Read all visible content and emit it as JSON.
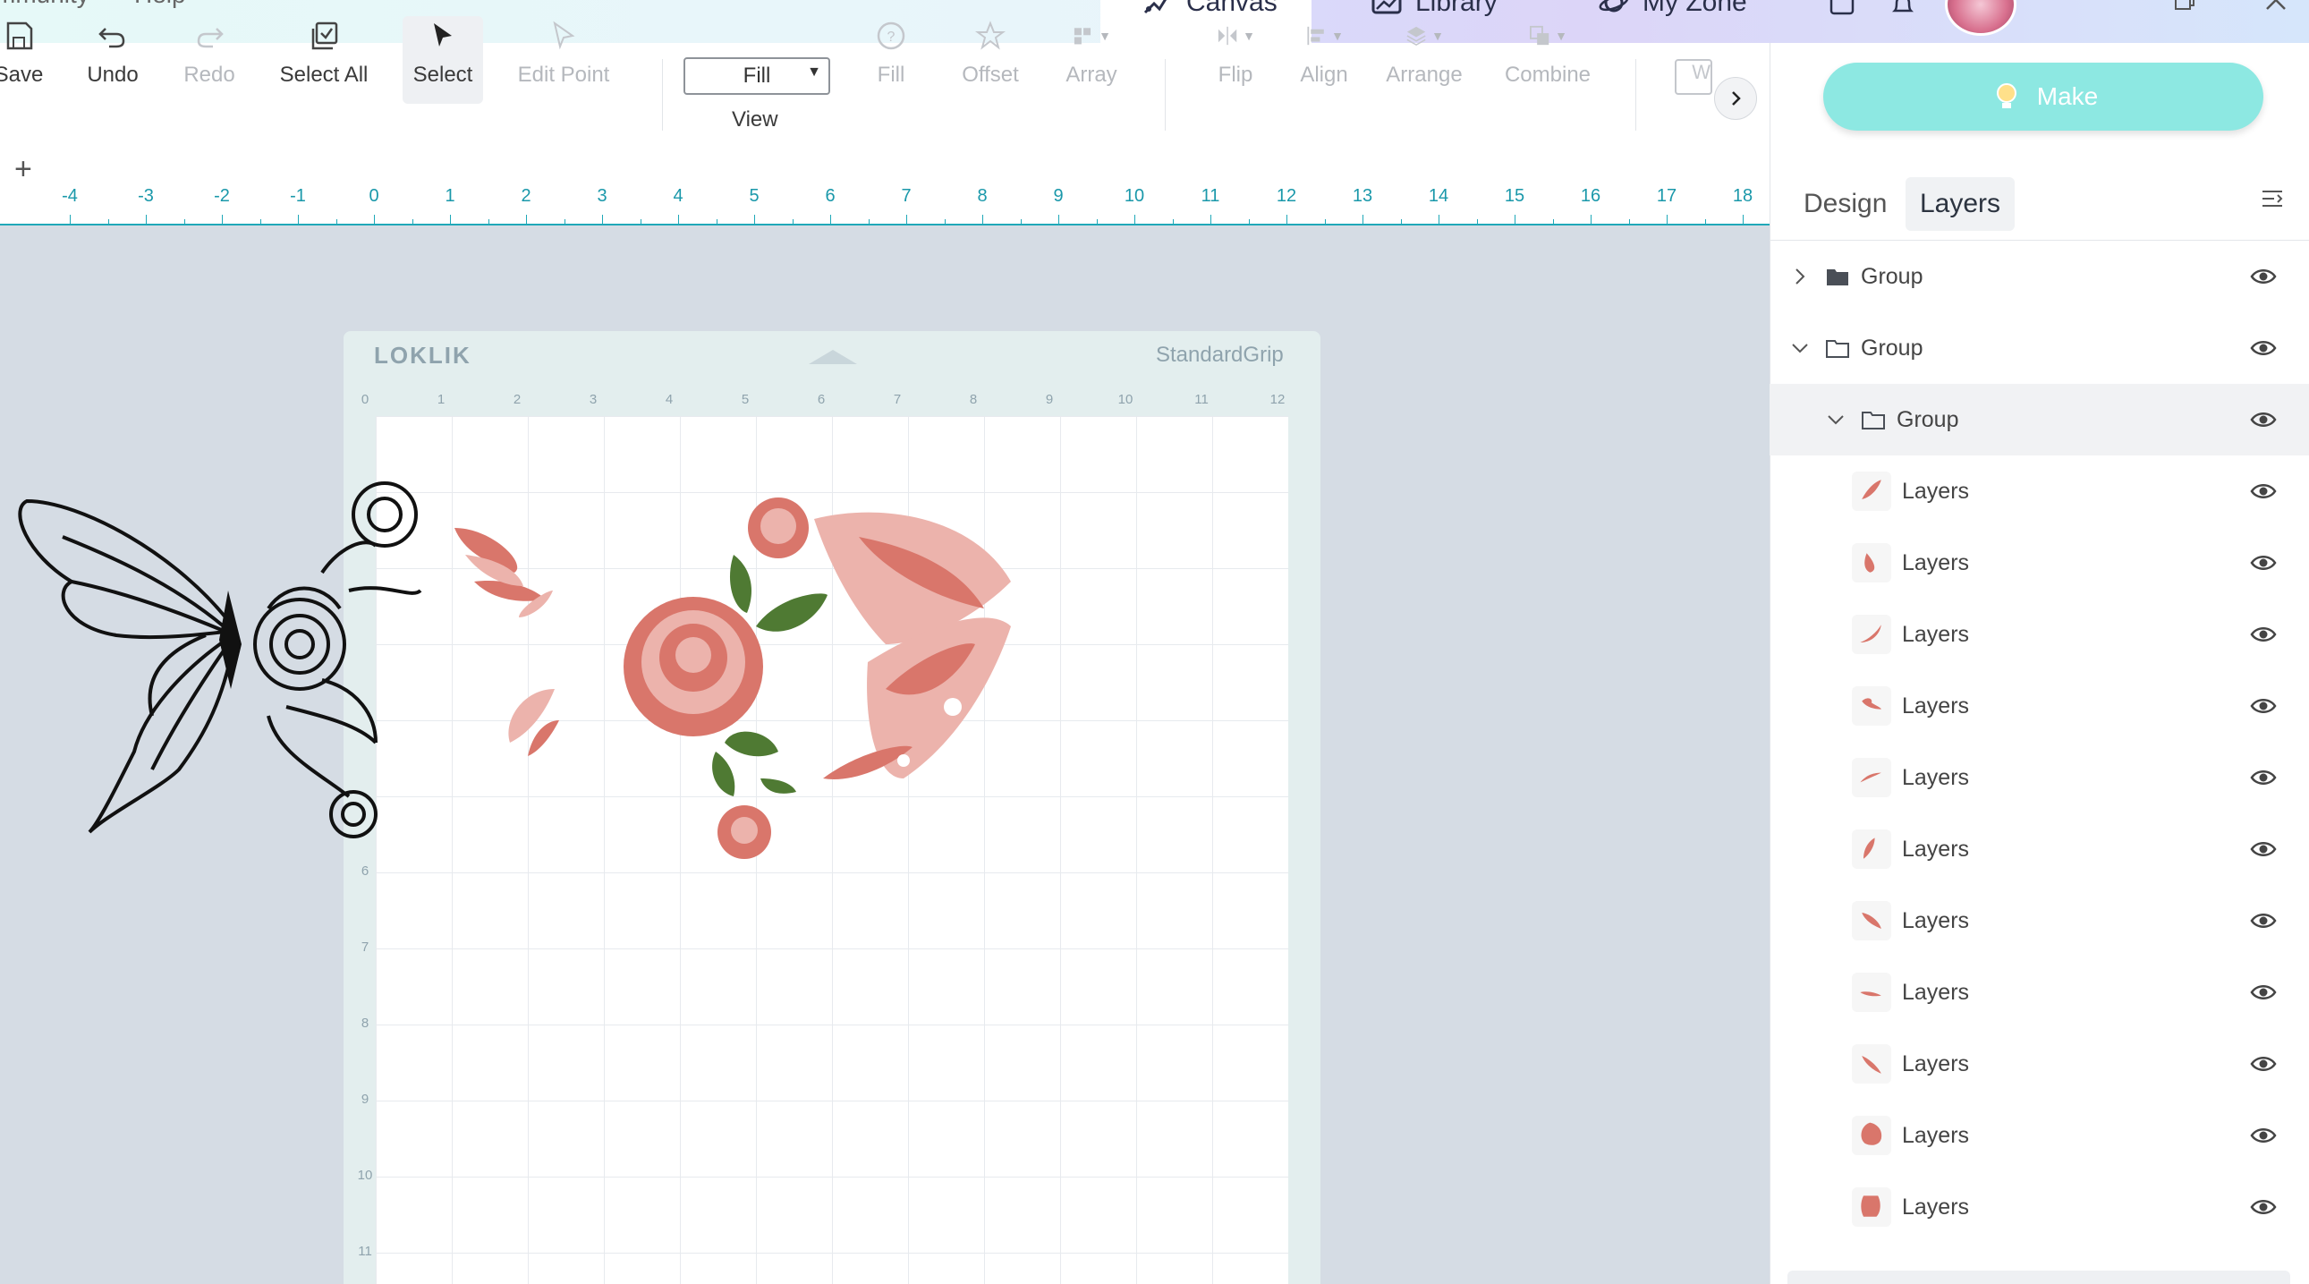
{
  "menu": {
    "community": "mmunity",
    "help": "Help"
  },
  "tabs": [
    {
      "label": "Canvas",
      "icon": "canvas-icon"
    },
    {
      "label": "Library",
      "icon": "library-icon"
    },
    {
      "label": "My Zone",
      "icon": "planet-icon"
    }
  ],
  "toolbar": {
    "save": "Save",
    "undo": "Undo",
    "redo": "Redo",
    "select_all": "Select All",
    "select": "Select",
    "edit_point": "Edit Point",
    "view_select_value": "Fill",
    "view": "View",
    "fill": "Fill",
    "offset": "Offset",
    "array": "Array",
    "flip": "Flip",
    "align": "Align",
    "arrange": "Arrange",
    "combine": "Combine",
    "cut_partial": "W"
  },
  "ruler": {
    "labels": [
      "-4",
      "-3",
      "-2",
      "-1",
      "0",
      "1",
      "2",
      "3",
      "4",
      "5",
      "6",
      "7",
      "8",
      "9",
      "10",
      "11",
      "12",
      "13",
      "14",
      "15",
      "16",
      "17",
      "18"
    ]
  },
  "mat": {
    "brand": "LOKLIK",
    "grip": "StandardGrip",
    "top_labels": [
      "0",
      "1",
      "2",
      "3",
      "4",
      "5",
      "6",
      "7",
      "8",
      "9",
      "10",
      "11",
      "12"
    ],
    "side_labels": [
      "6",
      "7",
      "8",
      "9",
      "10",
      "11"
    ]
  },
  "panel": {
    "make": "Make",
    "tabs": {
      "design": "Design",
      "layers": "Layers"
    },
    "rows": [
      {
        "label": "Group"
      },
      {
        "label": "Group"
      },
      {
        "label": "Group"
      },
      {
        "label": "Layers"
      },
      {
        "label": "Layers"
      },
      {
        "label": "Layers"
      },
      {
        "label": "Layers"
      },
      {
        "label": "Layers"
      },
      {
        "label": "Layers"
      },
      {
        "label": "Layers"
      },
      {
        "label": "Layers"
      },
      {
        "label": "Layers"
      },
      {
        "label": "Layers"
      },
      {
        "label": "Layers"
      }
    ]
  },
  "colors": {
    "accent": "#1fa8b8",
    "make": "#8de8e2",
    "rose": "#d9766b",
    "rose_light": "#ecb3ac",
    "leaf": "#4f7a33"
  }
}
